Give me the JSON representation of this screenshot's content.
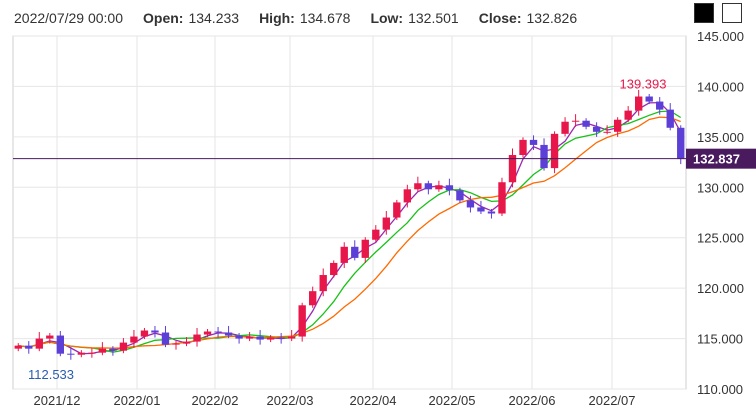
{
  "info": {
    "datetime": "2022/07/29 00:00",
    "open_label": "Open:",
    "open": "134.233",
    "high_label": "High:",
    "high": "134.678",
    "low_label": "Low:",
    "low": "132.501",
    "close_label": "Close:",
    "close": "132.826"
  },
  "theme_buttons": [
    "dark",
    "light"
  ],
  "colors": {
    "up": "#e8174a",
    "down": "#5b3fd6",
    "ma_short": "#9c27b0",
    "ma_mid": "#17c117",
    "ma_long": "#ff6a00",
    "price_line": "#4a1a5e",
    "hi_label": "#e8174a",
    "lo_label": "#2a5db0",
    "grid": "#e6e6e6"
  },
  "chart_data": {
    "type": "candlestick",
    "ylim": [
      110,
      145
    ],
    "y_ticks": [
      "145.000",
      "140.000",
      "135.000",
      "130.000",
      "125.000",
      "120.000",
      "115.000",
      "110.000"
    ],
    "x_ticks": [
      "2021/12",
      "2022/01",
      "2022/02",
      "2022/03",
      "2022/04",
      "2022/05",
      "2022/06",
      "2022/07"
    ],
    "current_price": "132.837",
    "high_marker": "139.393",
    "low_marker": "112.533",
    "series_close": [
      114.3,
      114.0,
      115.0,
      115.3,
      113.5,
      113.4,
      113.6,
      113.6,
      114.0,
      113.8,
      114.6,
      115.2,
      115.8,
      115.6,
      114.4,
      114.5,
      114.7,
      115.4,
      115.7,
      115.6,
      115.3,
      115.0,
      115.2,
      114.9,
      115.1,
      115.0,
      115.2,
      118.3,
      119.7,
      121.3,
      122.5,
      124.1,
      123.0,
      124.8,
      125.8,
      127.0,
      128.5,
      129.8,
      130.4,
      129.8,
      130.2,
      129.7,
      128.7,
      128.0,
      127.6,
      127.4,
      130.5,
      133.2,
      134.7,
      134.2,
      131.9,
      135.3,
      136.5,
      136.6,
      136.0,
      135.5,
      135.5,
      136.7,
      137.6,
      139.0,
      138.5,
      137.7,
      135.9,
      132.8
    ]
  }
}
